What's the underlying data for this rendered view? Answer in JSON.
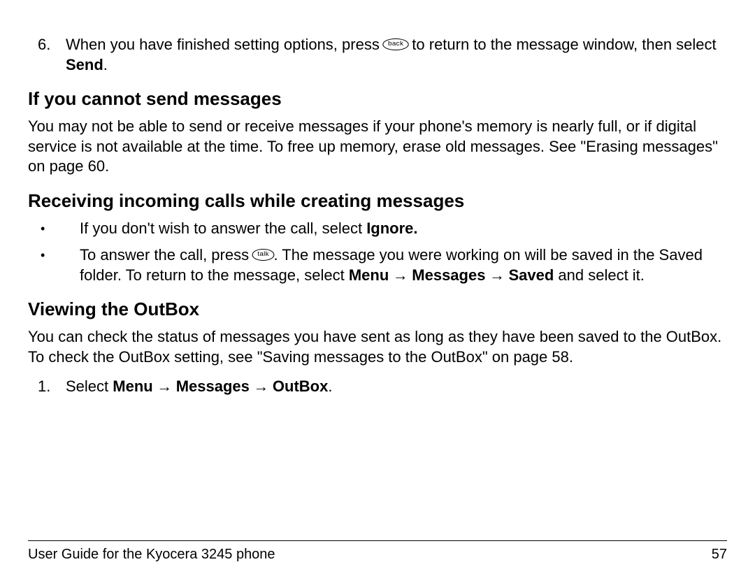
{
  "step6": {
    "number": "6.",
    "text_before_icon": "When you have finished setting options, press ",
    "icon_label": "back",
    "text_after_icon": " to return to the message window, then select ",
    "bold_end": "Send",
    "period": "."
  },
  "heading1": "If you cannot send messages",
  "para1": "You may not be able to send or receive messages if your phone's memory is nearly full, or if digital service is not available at the time. To free up memory, erase old messages. See \"Erasing messages\" on page 60.",
  "heading2": "Receiving incoming calls while creating messages",
  "bullet1": {
    "text": "If you don't wish to answer the call, select ",
    "bold": "Ignore."
  },
  "bullet2": {
    "text_before_icon": "To answer the call, press ",
    "icon_label": "talk",
    "text_after_icon": ". The message you were working on will be saved in the Saved folder. To return to the message, select ",
    "bold1": "Menu",
    "arrow1": " → ",
    "bold2": "Messages",
    "arrow2": " → ",
    "bold3": "Saved",
    "tail": " and select it."
  },
  "heading3": "Viewing the OutBox",
  "para3": "You can check the status of messages you have sent as long as they have been saved to the OutBox. To check the OutBox setting, see \"Saving messages to the OutBox\" on page 58.",
  "step1_outbox": {
    "number": "1.",
    "text": "Select ",
    "bold1": "Menu",
    "arrow1": " → ",
    "bold2": "Messages",
    "arrow2": " → ",
    "bold3": "OutBox",
    "period": "."
  },
  "footer": {
    "left": "User Guide for the Kyocera 3245 phone",
    "right": "57"
  }
}
